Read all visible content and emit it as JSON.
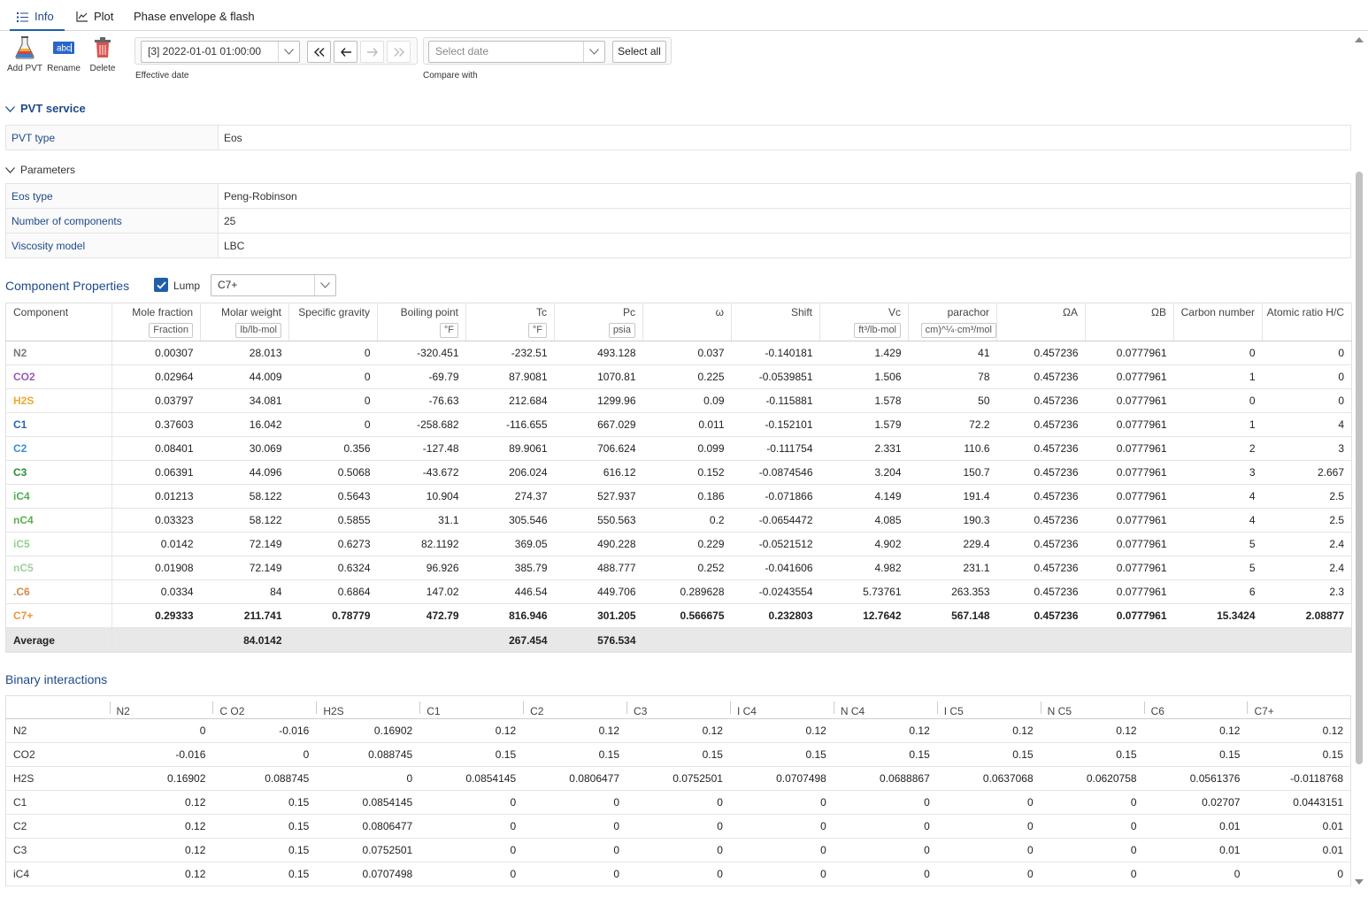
{
  "tabs": [
    {
      "label": "Info"
    },
    {
      "label": "Plot"
    },
    {
      "label": "Phase envelope & flash"
    }
  ],
  "toolbar": {
    "add_pvt": "Add PVT",
    "rename": "Rename",
    "delete": "Delete",
    "effective_date_value": "[3] 2022-01-01 01:00:00",
    "effective_date_caption": "Effective date",
    "compare_placeholder": "Select date",
    "compare_caption": "Compare with",
    "select_all": "Select all"
  },
  "pvt_service": {
    "title": "PVT service",
    "rows": [
      {
        "key": "PVT type",
        "value": "Eos"
      }
    ]
  },
  "parameters": {
    "title": "Parameters",
    "rows": [
      {
        "key": "Eos type",
        "value": "Peng-Robinson"
      },
      {
        "key": "Number of components",
        "value": "25"
      },
      {
        "key": "Viscosity model",
        "value": "LBC"
      }
    ]
  },
  "component_properties": {
    "title": "Component Properties",
    "lump_label": "Lump",
    "lump_checked": true,
    "lump_value": "C7+",
    "columns": [
      {
        "name": "Component",
        "unit": ""
      },
      {
        "name": "Mole fraction",
        "unit": "Fraction"
      },
      {
        "name": "Molar weight",
        "unit": "lb/lb-mol"
      },
      {
        "name": "Specific gravity",
        "unit": ""
      },
      {
        "name": "Boiling point",
        "unit": "°F"
      },
      {
        "name": "Tc",
        "unit": "°F"
      },
      {
        "name": "Pc",
        "unit": "psia"
      },
      {
        "name": "ω",
        "unit": ""
      },
      {
        "name": "Shift",
        "unit": ""
      },
      {
        "name": "Vc",
        "unit": "ft³/lb-mol"
      },
      {
        "name": "parachor",
        "unit": "cm)^¼·cm³/mol"
      },
      {
        "name": "ΩA",
        "unit": ""
      },
      {
        "name": "ΩB",
        "unit": ""
      },
      {
        "name": "Carbon number",
        "unit": ""
      },
      {
        "name": "Atomic ratio H/C",
        "unit": ""
      }
    ],
    "rows": [
      {
        "name": "N2",
        "color": "#7a7a7a",
        "cells": [
          "0.00307",
          "28.013",
          "0",
          "-320.451",
          "-232.51",
          "493.128",
          "0.037",
          "-0.140181",
          "1.429",
          "41",
          "0.457236",
          "0.0777961",
          "0",
          "0"
        ]
      },
      {
        "name": "CO2",
        "color": "#9b59b6",
        "cells": [
          "0.02964",
          "44.009",
          "0",
          "-69.79",
          "87.9081",
          "1070.81",
          "0.225",
          "-0.0539851",
          "1.506",
          "78",
          "0.457236",
          "0.0777961",
          "1",
          "0"
        ]
      },
      {
        "name": "H2S",
        "color": "#f0a830",
        "cells": [
          "0.03797",
          "34.081",
          "0",
          "-76.63",
          "212.684",
          "1299.96",
          "0.09",
          "-0.115881",
          "1.578",
          "50",
          "0.457236",
          "0.0777961",
          "0",
          "0"
        ]
      },
      {
        "name": "C1",
        "color": "#2a66b0",
        "cells": [
          "0.37603",
          "16.042",
          "0",
          "-258.682",
          "-116.655",
          "667.029",
          "0.011",
          "-0.152101",
          "1.579",
          "72.2",
          "0.457236",
          "0.0777961",
          "1",
          "4"
        ]
      },
      {
        "name": "C2",
        "color": "#3a8fd0",
        "cells": [
          "0.08401",
          "30.069",
          "0.356",
          "-127.48",
          "89.9061",
          "706.624",
          "0.099",
          "-0.111754",
          "2.331",
          "110.6",
          "0.457236",
          "0.0777961",
          "2",
          "3"
        ]
      },
      {
        "name": "C3",
        "color": "#2e8b3a",
        "cells": [
          "0.06391",
          "44.096",
          "0.5068",
          "-43.672",
          "206.024",
          "616.12",
          "0.152",
          "-0.0874546",
          "3.204",
          "150.7",
          "0.457236",
          "0.0777961",
          "3",
          "2.667"
        ]
      },
      {
        "name": "iC4",
        "color": "#4caf50",
        "cells": [
          "0.01213",
          "58.122",
          "0.5643",
          "10.904",
          "274.37",
          "527.937",
          "0.186",
          "-0.071866",
          "4.149",
          "191.4",
          "0.457236",
          "0.0777961",
          "4",
          "2.5"
        ]
      },
      {
        "name": "nC4",
        "color": "#5cae4a",
        "cells": [
          "0.03323",
          "58.122",
          "0.5855",
          "31.1",
          "305.546",
          "550.563",
          "0.2",
          "-0.0654472",
          "4.085",
          "190.3",
          "0.457236",
          "0.0777961",
          "4",
          "2.5"
        ]
      },
      {
        "name": "iC5",
        "color": "#8fd18a",
        "cells": [
          "0.0142",
          "72.149",
          "0.6273",
          "82.1192",
          "369.05",
          "490.228",
          "0.229",
          "-0.0521512",
          "4.902",
          "229.4",
          "0.457236",
          "0.0777961",
          "5",
          "2.4"
        ]
      },
      {
        "name": "nC5",
        "color": "#9ed19a",
        "cells": [
          "0.01908",
          "72.149",
          "0.6324",
          "96.926",
          "385.79",
          "488.777",
          "0.252",
          "-0.041606",
          "4.982",
          "231.1",
          "0.457236",
          "0.0777961",
          "5",
          "2.4"
        ]
      },
      {
        "name": ".C6",
        "color": "#d2884a",
        "cells": [
          "0.0334",
          "84",
          "0.6864",
          "147.02",
          "446.54",
          "449.706",
          "0.289628",
          "-0.0243554",
          "5.73761",
          "263.353",
          "0.457236",
          "0.0777961",
          "6",
          "2.3"
        ]
      },
      {
        "name": "C7+",
        "color": "#e8963a",
        "lump": true,
        "cells": [
          "0.29333",
          "211.741",
          "0.78779",
          "472.79",
          "816.946",
          "301.205",
          "0.566675",
          "0.232803",
          "12.7642",
          "567.148",
          "0.457236",
          "0.0777961",
          "15.3424",
          "2.08877"
        ]
      }
    ],
    "average": {
      "label": "Average",
      "cells": [
        "",
        "84.0142",
        "",
        "",
        "267.454",
        "576.534",
        "",
        "",
        "",
        "",
        "",
        "",
        "",
        ""
      ]
    }
  },
  "binary_interactions": {
    "title": "Binary interactions",
    "columns": [
      "N2",
      "C O2",
      "H2S",
      "C1",
      "C2",
      "C3",
      "I C4",
      "N C4",
      "I C5",
      "N C5",
      "C6",
      "C7+"
    ],
    "rows": [
      {
        "name": "N2",
        "cells": [
          "0",
          "-0.016",
          "0.16902",
          "0.12",
          "0.12",
          "0.12",
          "0.12",
          "0.12",
          "0.12",
          "0.12",
          "0.12",
          "0.12"
        ]
      },
      {
        "name": "CO2",
        "cells": [
          "-0.016",
          "0",
          "0.088745",
          "0.15",
          "0.15",
          "0.15",
          "0.15",
          "0.15",
          "0.15",
          "0.15",
          "0.15",
          "0.15"
        ]
      },
      {
        "name": "H2S",
        "cells": [
          "0.16902",
          "0.088745",
          "0",
          "0.0854145",
          "0.0806477",
          "0.0752501",
          "0.0707498",
          "0.0688867",
          "0.0637068",
          "0.0620758",
          "0.0561376",
          "-0.0118768"
        ]
      },
      {
        "name": "C1",
        "cells": [
          "0.12",
          "0.15",
          "0.0854145",
          "0",
          "0",
          "0",
          "0",
          "0",
          "0",
          "0",
          "0.02707",
          "0.0443151"
        ]
      },
      {
        "name": "C2",
        "cells": [
          "0.12",
          "0.15",
          "0.0806477",
          "0",
          "0",
          "0",
          "0",
          "0",
          "0",
          "0",
          "0.01",
          "0.01"
        ]
      },
      {
        "name": "C3",
        "cells": [
          "0.12",
          "0.15",
          "0.0752501",
          "0",
          "0",
          "0",
          "0",
          "0",
          "0",
          "0",
          "0.01",
          "0.01"
        ]
      },
      {
        "name": "iC4",
        "cells": [
          "0.12",
          "0.15",
          "0.0707498",
          "0",
          "0",
          "0",
          "0",
          "0",
          "0",
          "0",
          "0",
          "0"
        ]
      }
    ]
  }
}
